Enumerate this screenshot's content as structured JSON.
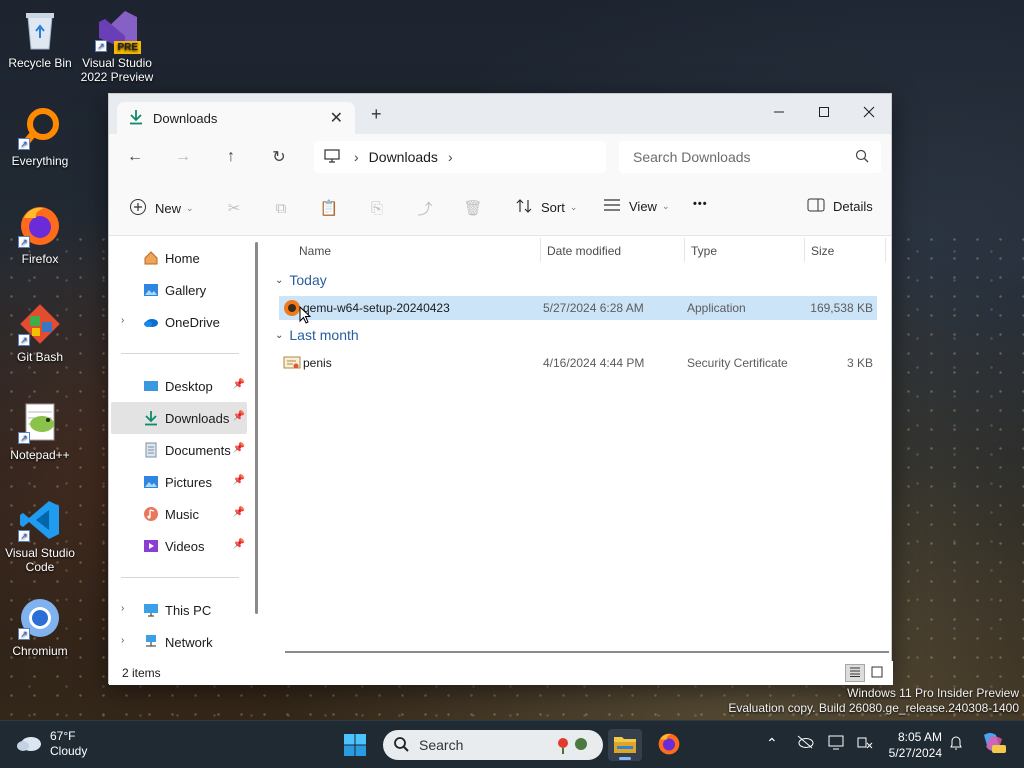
{
  "desktop": {
    "icons": [
      {
        "label": "Recycle Bin"
      },
      {
        "label": "Visual Studio 2022 Preview",
        "badge": "PRE"
      },
      {
        "label": "Everything"
      },
      {
        "label": "Firefox"
      },
      {
        "label": "Git Bash"
      },
      {
        "label": "Notepad++"
      },
      {
        "label": "Visual Studio Code"
      },
      {
        "label": "Chromium"
      }
    ],
    "watermark_line1": "Windows 11 Pro Insider Preview",
    "watermark_line2": "Evaluation copy. Build 26080.ge_release.240308-1400"
  },
  "explorer": {
    "tab_title": "Downloads",
    "new_tab": "+",
    "address": {
      "crumb": "Downloads"
    },
    "search_placeholder": "Search Downloads",
    "toolbar": {
      "new_label": "New",
      "sort_label": "Sort",
      "view_label": "View",
      "more_label": "•••",
      "details_label": "Details"
    },
    "sidebar": {
      "home": "Home",
      "gallery": "Gallery",
      "onedrive": "OneDrive",
      "desktop": "Desktop",
      "downloads": "Downloads",
      "documents": "Documents",
      "pictures": "Pictures",
      "music": "Music",
      "videos": "Videos",
      "thispc": "This PC",
      "network": "Network"
    },
    "columns": {
      "name": "Name",
      "date": "Date modified",
      "type": "Type",
      "size": "Size"
    },
    "groups": [
      {
        "label": "Today",
        "files": [
          {
            "name": "qemu-w64-setup-20240423",
            "date": "5/27/2024 6:28 AM",
            "type": "Application",
            "size": "169,538 KB",
            "selected": true
          }
        ]
      },
      {
        "label": "Last month",
        "files": [
          {
            "name": "penis",
            "date": "4/16/2024 4:44 PM",
            "type": "Security Certificate",
            "size": "3 KB",
            "selected": false
          }
        ]
      }
    ],
    "status_items": "2 items"
  },
  "taskbar": {
    "weather_temp": "67°F",
    "weather_desc": "Cloudy",
    "search_placeholder": "Search",
    "time": "8:05 AM",
    "date": "5/27/2024"
  },
  "colors": {
    "accent": "#0067c0",
    "selection": "#cce4f7",
    "group_text": "#2a5d9e",
    "taskbar_bg": "#1f2a33"
  }
}
